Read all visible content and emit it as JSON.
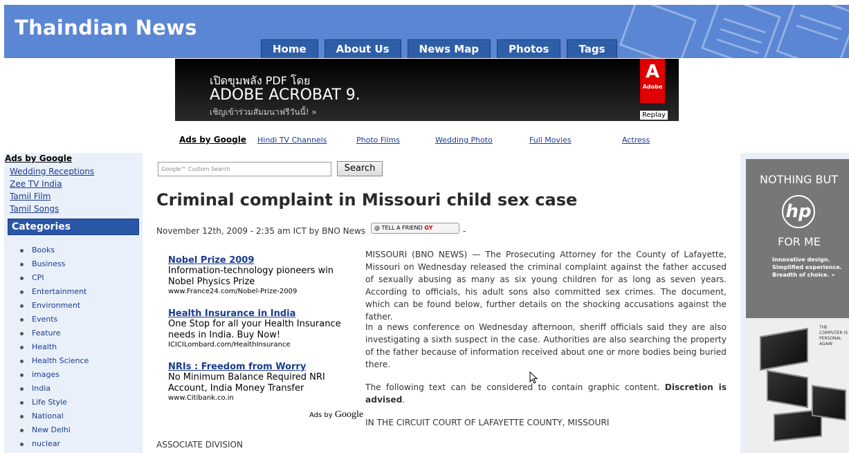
{
  "header": {
    "site_title": "Thaindian News",
    "nav": [
      "Home",
      "About Us",
      "News Map",
      "Photos",
      "Tags"
    ]
  },
  "banner_ad": {
    "thai_line": "เปิดขุมพลัง PDF โดย",
    "product": "ADOBE ACROBAT 9.",
    "sub_line": "เชิญเข้าร่วมสัมมนาฟรีวันนี้! »",
    "logo_text": "Adobe",
    "replay": "Replay",
    "brand_color": "#e00000"
  },
  "top_ads": {
    "header": "Ads by Google",
    "links": [
      "Hindi TV Channels",
      "Photo Films",
      "Wedding Photo",
      "Full Movies",
      "Actress"
    ]
  },
  "sidebar": {
    "ads_header": "Ads by Google",
    "ad_links": [
      "Wedding Receptions",
      "Zee TV India",
      "Tamil Film",
      "Tamil Songs"
    ],
    "categories_header": "Categories",
    "categories": [
      "Books",
      "Business",
      "CPI",
      "Entertainment",
      "Environment",
      "Events",
      "Feature",
      "Health",
      "Health Science",
      "images",
      "India",
      "Life Style",
      "National",
      "New Delhi",
      "nuclear"
    ]
  },
  "search": {
    "placeholder": "Google™ Custom Search",
    "button": "Search"
  },
  "article": {
    "title": "Criminal complaint in Missouri child sex case",
    "meta": "November 12th, 2009 - 2:35 am ICT by BNO News",
    "tell_friend": "TELL A FRIEND",
    "meta_dash": "-",
    "paragraphs": [
      "MISSOURI (BNO NEWS) — The Prosecuting Attorney for the County of Lafayette, Missouri on Wednesday released the criminal complaint against the father accused of sexually abusing as many as six young children for as long as seven years. According to officials, his adult sons also committed sex crimes. The document, which can be found below, further details on the shocking accusations against the father.",
      "In a news conference on Wednesday afternoon, sheriff officials said they are also investigating a sixth suspect in the case. Authorities are also searching the property of the father because of information received about one or more bodies being buried there."
    ],
    "graphic_pre": "The following text can be considered to contain graphic content.",
    "graphic_bold": "Discretion is advised",
    "graphic_post": ".",
    "court": "IN THE CIRCUIT COURT OF LAFAYETTE COUNTY, MISSOURI",
    "division": "ASSOCIATE DIVISION"
  },
  "inline_ads": [
    {
      "title": "Nobel Prize 2009",
      "desc": "Information-technology pioneers win Nobel Physics Prize",
      "url": "www.France24.com/Nobel-Prize-2009"
    },
    {
      "title": "Health Insurance in India",
      "desc": "One Stop for all your Health Insurance needs in India. Buy Now!",
      "url": "ICICILombard.com/HealthInsurance"
    },
    {
      "title": "NRIs : Freedom from Worry",
      "desc": "No Minimum Balance Required NRI Account, India Money Transfer",
      "url": "www.Citibank.co.in"
    }
  ],
  "inline_ads_footer": {
    "prefix": "Ads by",
    "brand": "Google"
  },
  "hp_ad": {
    "line1": "NOTHING BUT",
    "logo": "hp",
    "line2": "FOR ME",
    "tagline": "Innovative design. Simplified experience. Breadth of choice. »",
    "slogan": "THE COMPUTER IS PERSONAL AGAIN"
  }
}
